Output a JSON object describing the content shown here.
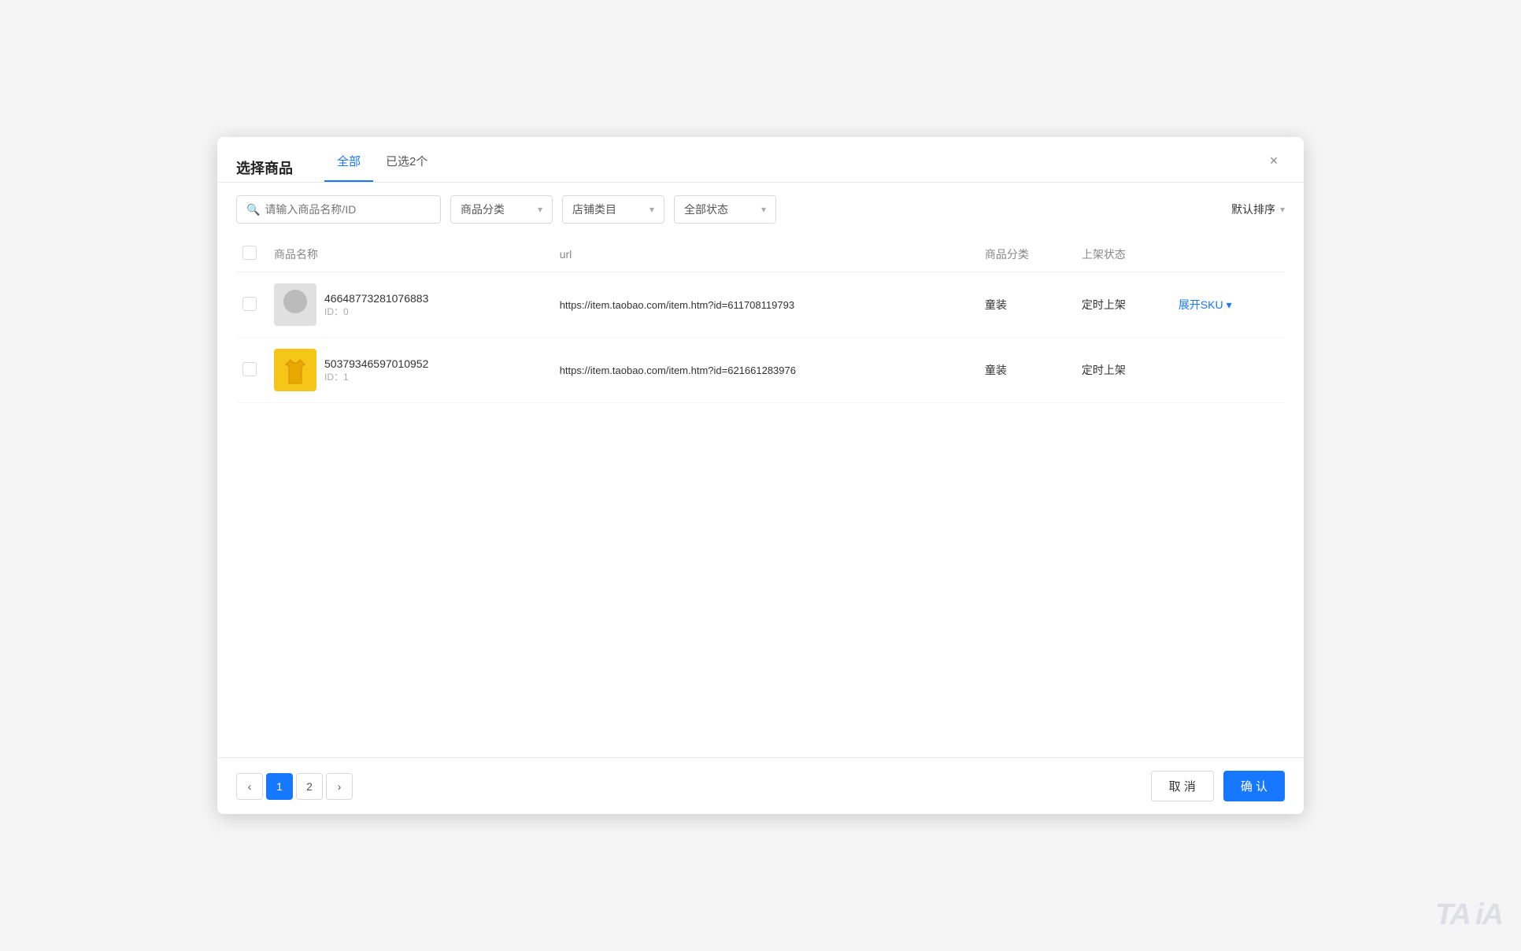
{
  "modal": {
    "title": "选择商品",
    "close_label": "×"
  },
  "tabs": [
    {
      "id": "all",
      "label": "全部",
      "active": true
    },
    {
      "id": "selected",
      "label": "已选2个",
      "active": false
    }
  ],
  "filters": {
    "search_placeholder": "请输入商品名称/ID",
    "category_label": "商品分类",
    "store_category_label": "店铺类目",
    "status_label": "全部状态",
    "sort_label": "默认排序"
  },
  "table": {
    "columns": [
      {
        "id": "checkbox",
        "label": ""
      },
      {
        "id": "name",
        "label": "商品名称"
      },
      {
        "id": "url",
        "label": "url"
      },
      {
        "id": "category",
        "label": "商品分类"
      },
      {
        "id": "status",
        "label": "上架状态"
      },
      {
        "id": "action",
        "label": ""
      }
    ],
    "rows": [
      {
        "id": "row-1",
        "name": "46648773281076883",
        "item_id": "ID：0",
        "url": "https://item.taobao.com/item.htm?id=611708119793",
        "category": "童装",
        "status": "定时上架",
        "has_expand_sku": true,
        "expand_sku_label": "展开SKU",
        "img_type": "1"
      },
      {
        "id": "row-2",
        "name": "50379346597010952",
        "item_id": "ID：1",
        "url": "https://item.taobao.com/item.htm?id=621661283976",
        "category": "童装",
        "status": "定时上架",
        "has_expand_sku": false,
        "expand_sku_label": "",
        "img_type": "2"
      }
    ]
  },
  "pagination": {
    "prev_label": "‹",
    "next_label": "›",
    "pages": [
      {
        "num": "1",
        "active": true
      },
      {
        "num": "2",
        "active": false
      }
    ]
  },
  "footer": {
    "cancel_label": "取 消",
    "confirm_label": "确 认"
  },
  "watermark": "TA iA"
}
